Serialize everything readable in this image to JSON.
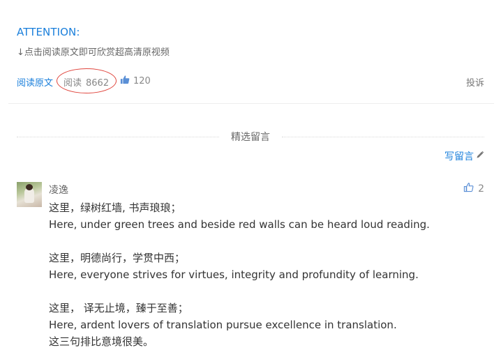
{
  "article": {
    "attention": "ATTENTION:",
    "note": "↓点击阅读原文即可欣赏超高清原视频"
  },
  "meta": {
    "read_original": "阅读原文",
    "read_label": "阅读",
    "read_count": "8662",
    "like_count": "120",
    "report": "投诉",
    "icons": {
      "like": "thumbs-up-icon"
    },
    "colors": {
      "link": "#1a7fdb",
      "annotation_circle": "#e0443c"
    }
  },
  "comments_section": {
    "title": "精选留言",
    "write_label": "写留言",
    "icons": {
      "write": "pencil-icon"
    }
  },
  "comments": [
    {
      "author": "凌逸",
      "likes": "2",
      "lines": [
        "这里，绿树红墙, 书声琅琅；",
        "Here, under green trees and beside red walls can be heard loud reading.",
        "",
        "这里，明德尚行，学贯中西；",
        "Here, everyone strives for virtues, integrity and profundity of learning.",
        "",
        "这里， 译无止境，臻于至善；",
        "Here, ardent lovers of translation pursue excellence in translation.",
        "这三句排比意境很美。"
      ]
    }
  ]
}
